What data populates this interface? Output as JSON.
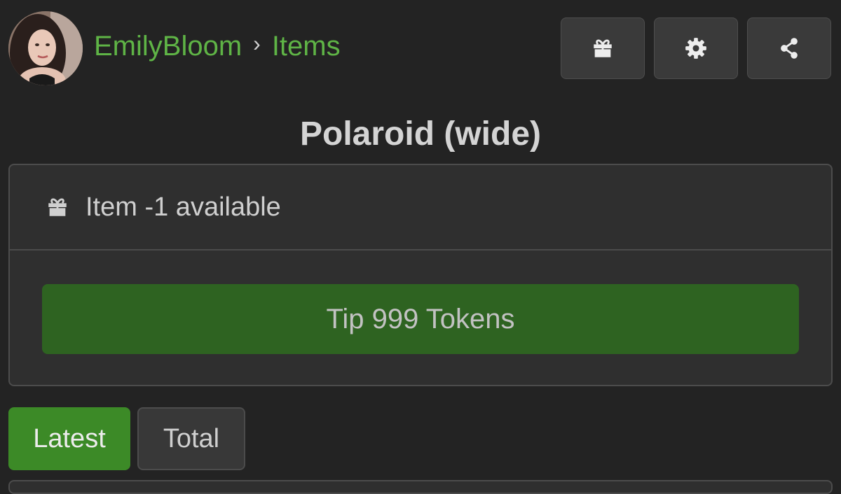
{
  "header": {
    "avatar_icon": "user-avatar-photo",
    "breadcrumb": {
      "user": "EmilyBloom",
      "separator": "›",
      "section": "Items"
    },
    "actions": [
      {
        "icon": "gift-icon"
      },
      {
        "icon": "gear-icon"
      },
      {
        "icon": "share-icon"
      }
    ]
  },
  "item": {
    "title": "Polaroid (wide)",
    "availability_icon": "gift-icon",
    "availability": "Item -1 available",
    "tip_button_label": "Tip 999 Tokens"
  },
  "tabs": {
    "latest": "Latest",
    "total": "Total",
    "active": "Latest"
  },
  "colors": {
    "accent_green": "#5fb446",
    "tip_button": "#2e6321",
    "active_tab": "#3c8a27",
    "background": "#232323"
  }
}
